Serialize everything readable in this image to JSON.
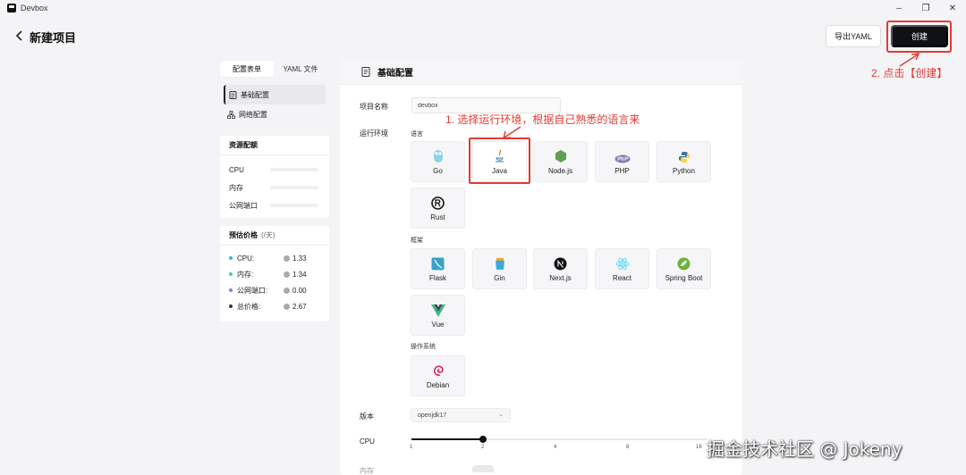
{
  "window": {
    "title": "Devbox",
    "minimize": "–",
    "maximize": "❐",
    "close": "✕"
  },
  "header": {
    "title": "新建项目",
    "export_label": "导出YAML",
    "create_label": "创建"
  },
  "annotations": {
    "step1": "1. 选择运行环境，根据自己熟悉的语言来",
    "step2": "2. 点击【创建】",
    "color": "#e23a32"
  },
  "tabs": [
    {
      "label": "配置表单",
      "active": true
    },
    {
      "label": "YAML 文件",
      "active": false
    }
  ],
  "nav": [
    {
      "label": "基础配置",
      "active": true
    },
    {
      "label": "网络配置",
      "active": false
    }
  ],
  "resources": {
    "title": "资源配额",
    "rows": [
      {
        "label": "CPU"
      },
      {
        "label": "内存"
      },
      {
        "label": "公网端口"
      }
    ]
  },
  "pricing": {
    "title": "预估价格",
    "unit": "(/天)",
    "rows": [
      {
        "label": "CPU:",
        "value": "1.33",
        "color": "#3bb7d8"
      },
      {
        "label": "内存:",
        "value": "1.34",
        "color": "#4cc9b0"
      },
      {
        "label": "公网端口:",
        "value": "0.00",
        "color": "#8a7cf0"
      },
      {
        "label": "总价格:",
        "value": "2.67",
        "color": "#333333"
      }
    ]
  },
  "main": {
    "section_title": "基础配置",
    "name_label": "项目名称",
    "name_value": "devbox",
    "runtime_label": "运行环境",
    "lang_label": "语言",
    "framework_label": "框架",
    "os_label": "操作系统",
    "languages": [
      {
        "label": "Go",
        "icon": "go-icon"
      },
      {
        "label": "Java",
        "icon": "java-icon",
        "selected": true
      },
      {
        "label": "Node.js",
        "icon": "nodejs-icon"
      },
      {
        "label": "PHP",
        "icon": "php-icon"
      },
      {
        "label": "Python",
        "icon": "python-icon"
      },
      {
        "label": "Rust",
        "icon": "rust-icon"
      }
    ],
    "frameworks": [
      {
        "label": "Flask",
        "icon": "flask-icon"
      },
      {
        "label": "Gin",
        "icon": "gin-icon"
      },
      {
        "label": "Next.js",
        "icon": "nextjs-icon"
      },
      {
        "label": "React",
        "icon": "react-icon"
      },
      {
        "label": "Spring Boot",
        "icon": "spring-boot-icon"
      },
      {
        "label": "Vue",
        "icon": "vue-icon"
      }
    ],
    "os": [
      {
        "label": "Debian",
        "icon": "debian-icon"
      }
    ],
    "version_label": "版本",
    "version_value": "openjdk17",
    "cpu_label": "CPU",
    "cpu_value": 2,
    "cpu_ticks": [
      "1",
      "2",
      "4",
      "8",
      "16"
    ],
    "memory_label": "内存"
  },
  "watermark": "掘金技术社区 @ Jokeny"
}
